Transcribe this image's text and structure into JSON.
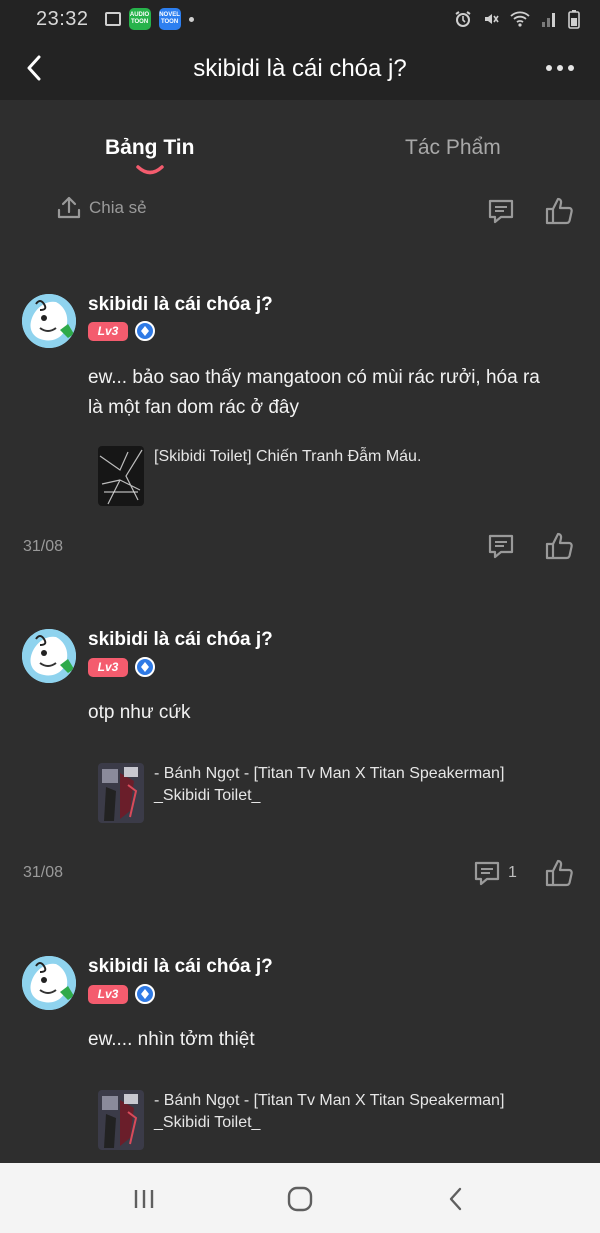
{
  "status_bar": {
    "time": "23:32",
    "apps": [
      {
        "name": "audio-toon",
        "line1": "AUDIO",
        "line2": "TOON"
      },
      {
        "name": "novel-toon",
        "line1": "NOVEL",
        "line2": "TOON"
      }
    ]
  },
  "header": {
    "title": "skibidi là cái chóa j?"
  },
  "tabs": [
    {
      "label": "Bảng Tin",
      "active": true
    },
    {
      "label": "Tác Phẩm",
      "active": false
    }
  ],
  "top_actions": {
    "share_label": "Chia sẻ"
  },
  "posts": [
    {
      "username": "skibidi là cái chóa j?",
      "level": "Lv3",
      "text_lines": [
        "ew... bảo sao thấy mangatoon có mùi rác rưởi, hóa ra",
        "là một fan dom rác ở đây"
      ],
      "work_title_lines": [
        "[Skibidi Toilet] Chiến Tranh Đẫm Máu."
      ],
      "date": "31/08",
      "comment_count": ""
    },
    {
      "username": "skibidi là cái chóa j?",
      "level": "Lv3",
      "text_lines": [
        "otp như cứk"
      ],
      "work_title_lines": [
        "- Bánh Ngọt - [Titan Tv Man X Titan Speakerman]",
        "_Skibidi Toilet_"
      ],
      "date": "31/08",
      "comment_count": "1"
    },
    {
      "username": "skibidi là cái chóa j?",
      "level": "Lv3",
      "text_lines": [
        "ew.... nhìn tởm thiệt"
      ],
      "work_title_lines": [
        "- Bánh Ngọt - [Titan Tv Man X Titan Speakerman]",
        "_Skibidi Toilet_"
      ],
      "date": "",
      "comment_count": ""
    }
  ],
  "colors": {
    "background": "#2e2e2e",
    "header": "#232323",
    "accent_pink": "#f45c6e",
    "verify_blue": "#2f7ae5"
  }
}
